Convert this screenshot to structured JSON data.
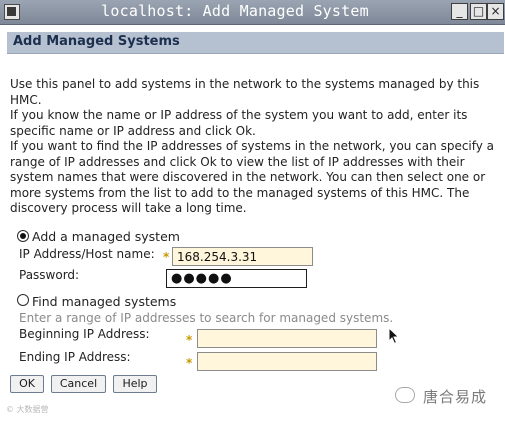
{
  "window": {
    "title": "localhost: Add Managed System",
    "buttons": {
      "minimize": "_",
      "maximize": "□",
      "close": "×"
    }
  },
  "header": {
    "title": "Add Managed Systems"
  },
  "description": {
    "p1": "Use this panel to add systems in the network to the systems managed by this HMC.",
    "p2": "If you know the name or IP address of the system you want to add, enter its specific name or IP address and click Ok.",
    "p3": "If you want to find the IP addresses of systems in the network, you can specify a range of IP addresses and click Ok to view the list of IP addresses with their system names that were discovered in the network. You can then select one or more systems from the list to add to the managed systems of this HMC. The discovery process will take a long time."
  },
  "add_option": {
    "label": "Add a managed system",
    "selected": true,
    "ip_label": "IP Address/Host name:",
    "ip_value": "168.254.3.31",
    "password_label": "Password:",
    "password_value": "●●●●●"
  },
  "find_option": {
    "label": "Find managed systems",
    "selected": false,
    "hint": "Enter a range of IP addresses to search for managed systems.",
    "begin_label": "Beginning IP Address:",
    "begin_value": "",
    "end_label": "Ending IP Address:",
    "end_value": ""
  },
  "required_marker": "*",
  "actions": {
    "ok": "OK",
    "cancel": "Cancel",
    "help": "Help"
  },
  "watermark": {
    "left": "© 大数据营",
    "right": "唐合易成"
  },
  "colors": {
    "header_bg": "#b5c1d0",
    "required_bg": "#fff6dc"
  }
}
